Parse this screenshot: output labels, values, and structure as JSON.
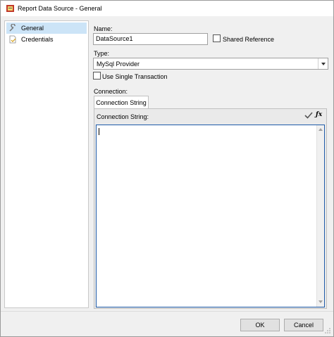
{
  "window": {
    "title": "Report Data Source - General",
    "app_icon": "report-data-source-icon"
  },
  "sidebar": {
    "items": [
      {
        "label": "General",
        "icon": "wrench-icon",
        "selected": true
      },
      {
        "label": "Credentials",
        "icon": "document-icon",
        "selected": false
      }
    ]
  },
  "form": {
    "name_label": "Name:",
    "name_value": "DataSource1",
    "shared_reference_label": "Shared Reference",
    "shared_reference_checked": false,
    "type_label": "Type:",
    "type_value": "MySql Provider",
    "single_transaction_label": "Use Single Transaction",
    "single_transaction_checked": false,
    "connection_label": "Connection:"
  },
  "connection": {
    "tab_label": "Connection String",
    "panel_label": "Connection String:",
    "value": ""
  },
  "footer": {
    "ok_label": "OK",
    "cancel_label": "Cancel"
  },
  "colors": {
    "selection": "#cce4f7",
    "focus_border": "#1e5aa8",
    "window_bg": "#f0f0f0"
  }
}
